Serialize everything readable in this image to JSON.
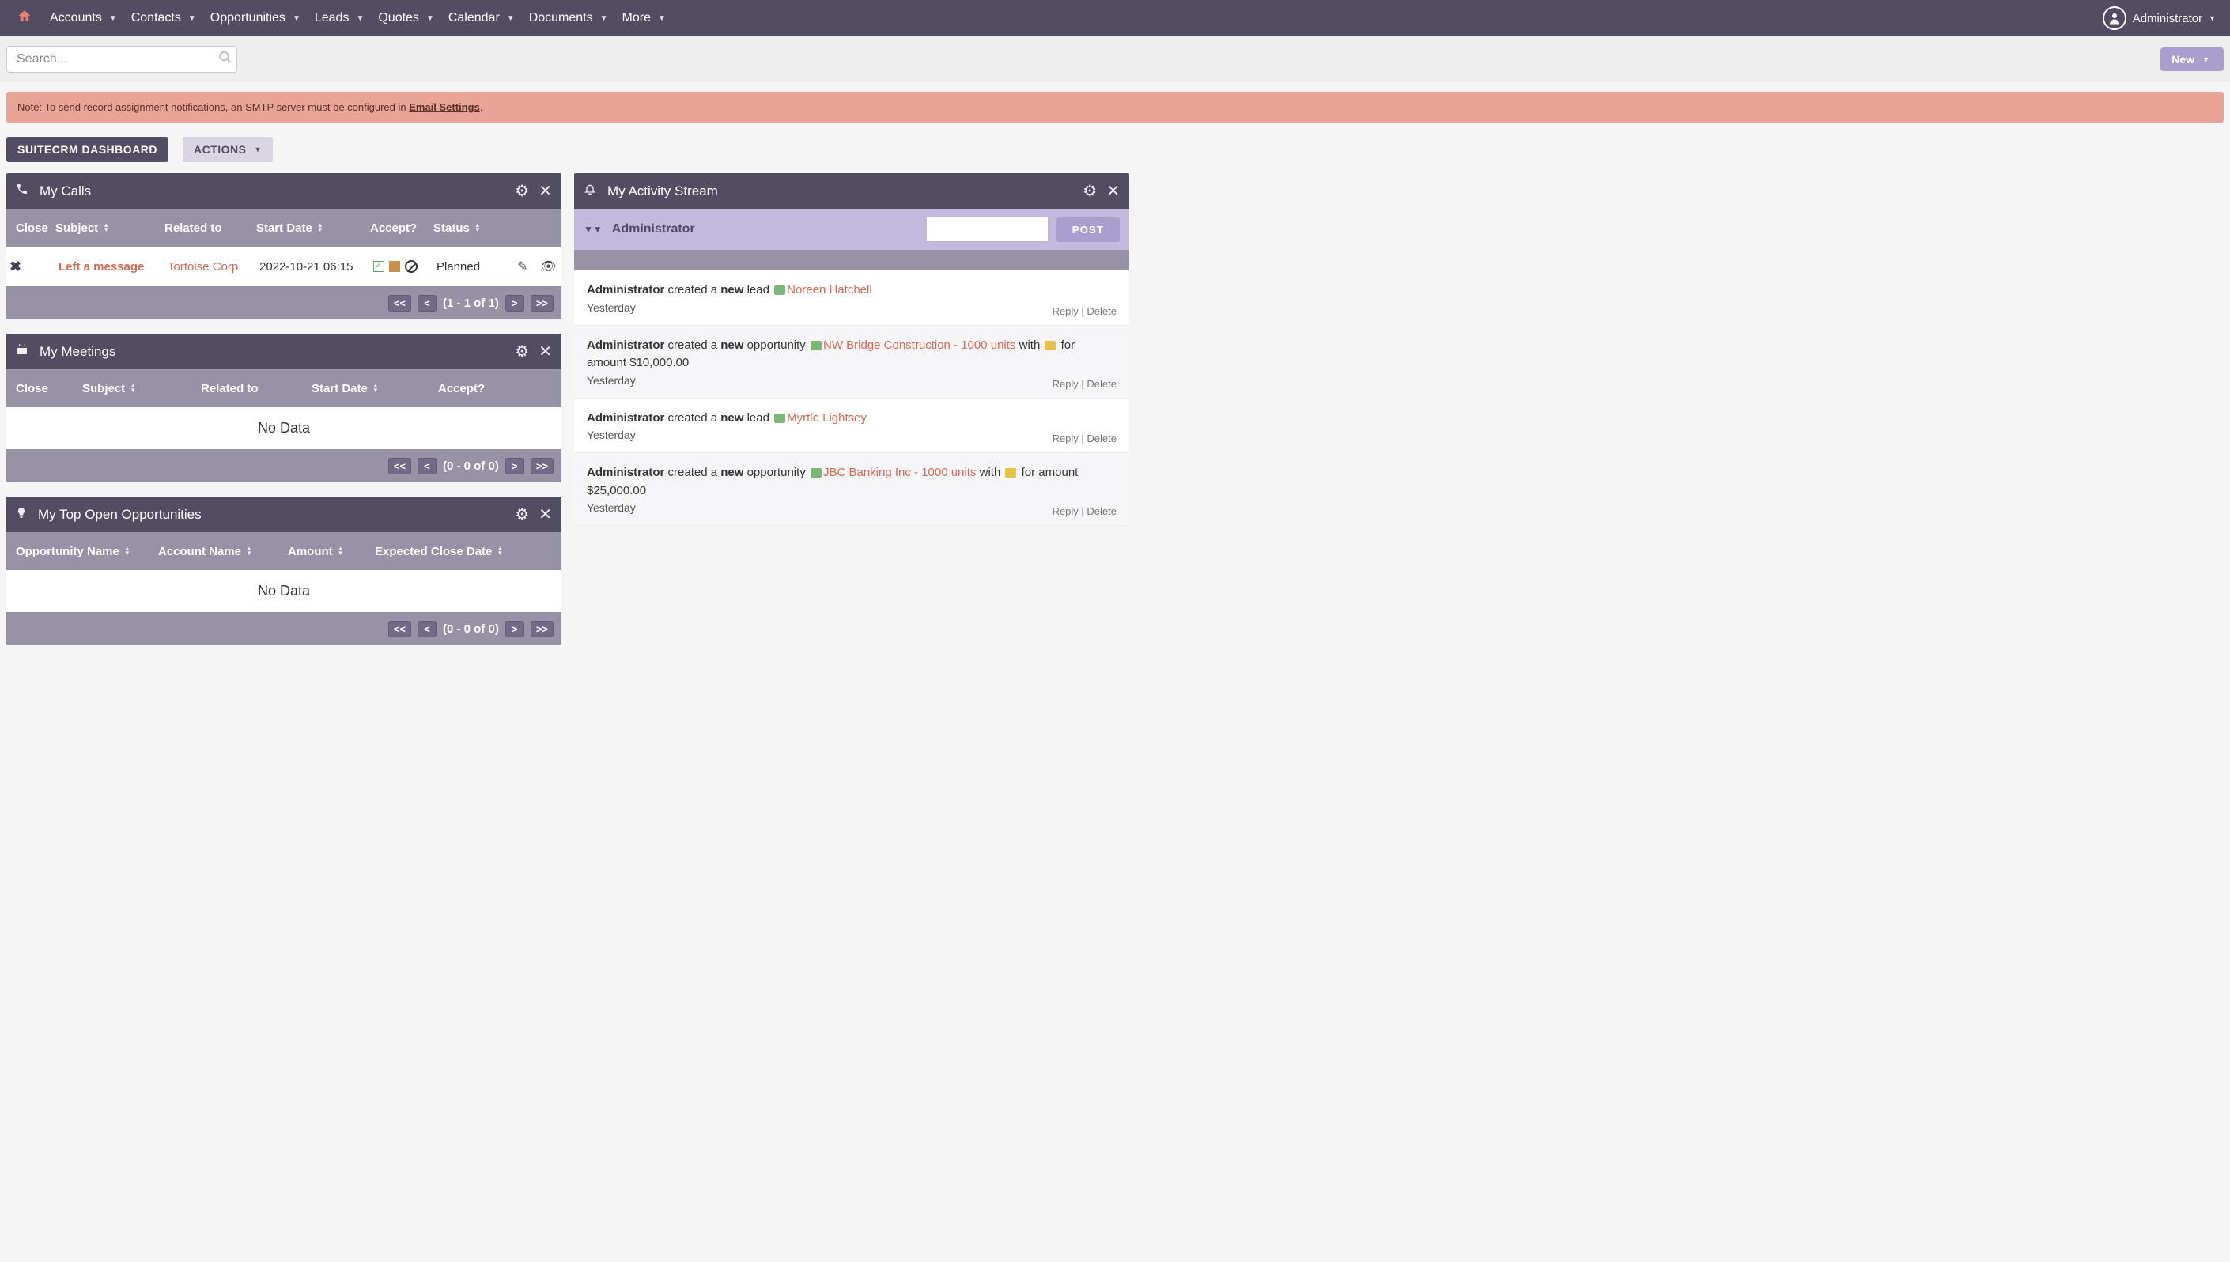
{
  "nav": {
    "items": [
      "Accounts",
      "Contacts",
      "Opportunities",
      "Leads",
      "Quotes",
      "Calendar",
      "Documents",
      "More"
    ],
    "user": "Administrator"
  },
  "search": {
    "placeholder": "Search..."
  },
  "new_btn": "New",
  "alert": {
    "prefix": "Note: To send record assignment notifications, an SMTP server must be configured in ",
    "link": "Email Settings",
    "suffix": "."
  },
  "page_title": "SUITECRM DASHBOARD",
  "actions_btn": "ACTIONS",
  "calls": {
    "title": "My Calls",
    "cols": {
      "close": "Close",
      "subject": "Subject",
      "related": "Related to",
      "start": "Start Date",
      "accept": "Accept?",
      "status": "Status"
    },
    "row": {
      "subject": "Left a message",
      "related": "Tortoise Corp",
      "start": "2022-10-21 06:15",
      "status": "Planned"
    },
    "pager": "(1 - 1 of 1)"
  },
  "meetings": {
    "title": "My Meetings",
    "cols": {
      "close": "Close",
      "subject": "Subject",
      "related": "Related to",
      "start": "Start Date",
      "accept": "Accept?"
    },
    "empty": "No Data",
    "pager": "(0 - 0 of 0)"
  },
  "opps": {
    "title": "My Top Open Opportunities",
    "cols": {
      "name": "Opportunity Name",
      "account": "Account Name",
      "amount": "Amount",
      "expected": "Expected Close Date"
    },
    "empty": "No Data",
    "pager": "(0 - 0 of 0)"
  },
  "activity": {
    "title": "My Activity Stream",
    "user": "Administrator",
    "post": "POST",
    "items": [
      {
        "actor": "Administrator",
        "verb": " created a ",
        "bold": "new",
        "kind": " lead ",
        "link": "Noreen Hatchell",
        "extra": "",
        "time": "Yesterday"
      },
      {
        "actor": "Administrator",
        "verb": " created a ",
        "bold": "new",
        "kind": " opportunity ",
        "link": "NW Bridge Construction - 1000 units",
        "extra_prefix": " with ",
        "extra_suffix": " for amount $10,000.00",
        "time": "Yesterday"
      },
      {
        "actor": "Administrator",
        "verb": " created a ",
        "bold": "new",
        "kind": " lead ",
        "link": "Myrtle Lightsey",
        "extra": "",
        "time": "Yesterday"
      },
      {
        "actor": "Administrator",
        "verb": " created a ",
        "bold": "new",
        "kind": " opportunity ",
        "link": "JBC Banking Inc - 1000 units",
        "extra_prefix": " with ",
        "extra_suffix": " for amount $25,000.00",
        "time": "Yesterday"
      }
    ],
    "reply": "Reply",
    "delete": "Delete"
  },
  "pg": {
    "first": "<<",
    "prev": "<",
    "next": ">",
    "last": ">>"
  }
}
